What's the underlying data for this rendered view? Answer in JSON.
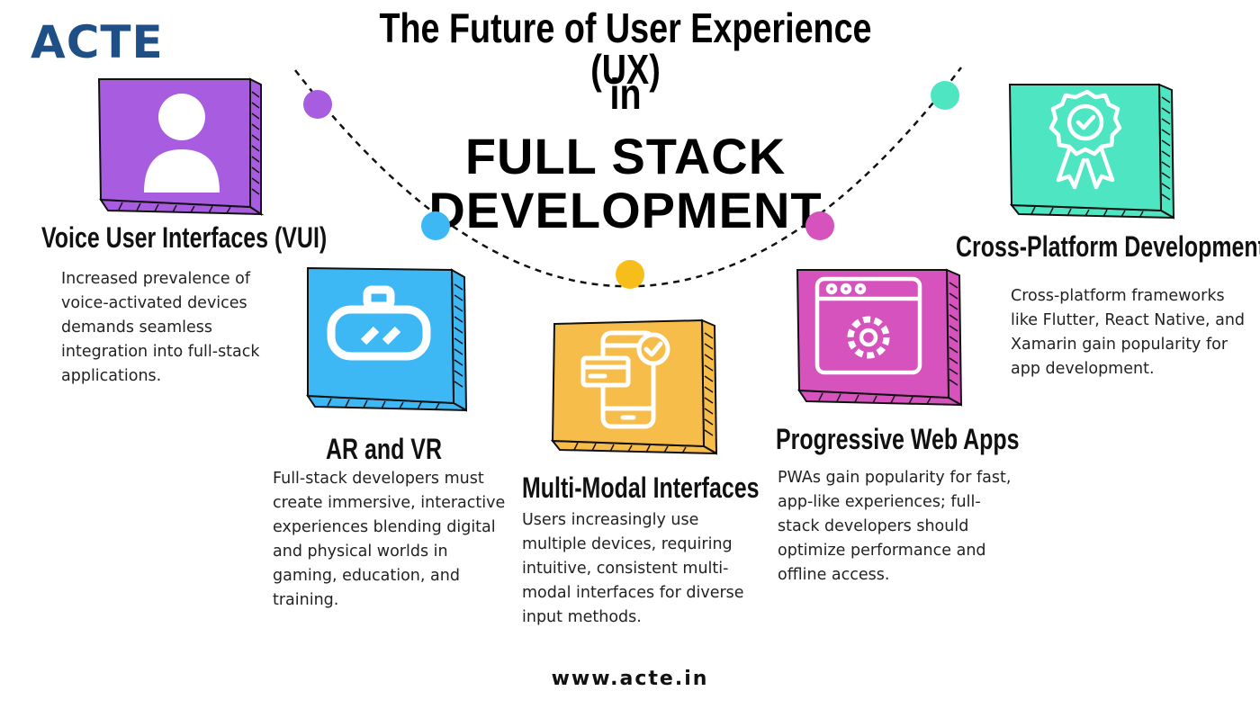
{
  "brand": {
    "logo": "ACTE",
    "footer_url": "www.acte.in"
  },
  "title": {
    "line1": "The Future of User Experience (UX)",
    "line2": "in",
    "line3": "FULL STACK",
    "line4": "DEVELOPMENT"
  },
  "items": [
    {
      "heading": "Voice User Interfaces (VUI)",
      "description": "Increased prevalence of voice-activated devices demands seamless integration into full-stack applications.",
      "icon": "user-icon",
      "color": "#a85ce0"
    },
    {
      "heading": "AR and VR",
      "description": "Full-stack developers must create immersive, interactive experiences blending digital and physical worlds in gaming, education, and training.",
      "icon": "vr-headset-icon",
      "color": "#3db8f5"
    },
    {
      "heading": "Multi-Modal Interfaces",
      "description": "Users increasingly use multiple devices, requiring intuitive, consistent multi-modal interfaces for diverse input methods.",
      "icon": "devices-icon",
      "color": "#f7bd4a"
    },
    {
      "heading": "Progressive Web Apps",
      "description": "PWAs gain popularity for fast, app-like experiences; full-stack developers should optimize performance and offline access.",
      "icon": "browser-gear-icon",
      "color": "#d652bd"
    },
    {
      "heading": "Cross-Platform Development",
      "description": "Cross-platform frameworks like Flutter, React Native, and Xamarin gain popularity for app development.",
      "icon": "award-badge-icon",
      "color": "#4ee6c2"
    }
  ],
  "colors": {
    "brand_blue": "#1e4f86",
    "dot_purple": "#a85ce0",
    "dot_blue": "#3db8f5",
    "dot_yellow": "#f7bd1a",
    "dot_magenta": "#d652bd",
    "dot_teal": "#4ee6c2"
  }
}
